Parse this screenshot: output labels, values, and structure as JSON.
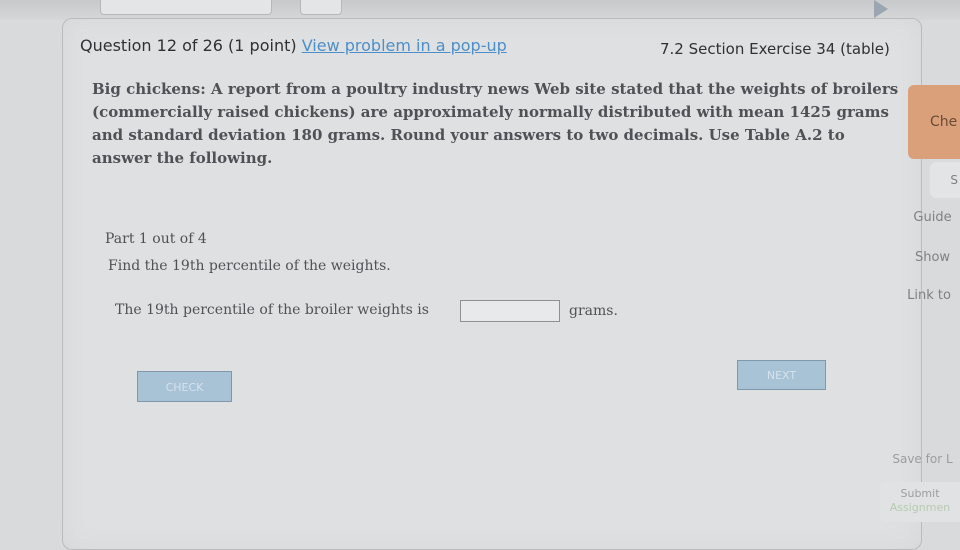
{
  "question": {
    "header_prefix": "Question 12 of 26 (1 point)",
    "popup_link": "View problem in a pop-up",
    "section": "7.2 Section Exercise 34 (table)"
  },
  "problem_lines": [
    "Big chickens: A report from a poultry industry news Web site stated that the weights of broilers",
    "(commercially raised chickens) are approximately normally distributed with mean 1425 grams",
    "and standard deviation 180 grams. Round your answers to two decimals. Use Table A.2 to",
    "answer the following."
  ],
  "part": {
    "title": "Part 1 out of 4",
    "task": "Find the 19th percentile of the weights.",
    "answer_prefix": "The 19th percentile of the broiler weights is",
    "answer_value": "",
    "answer_unit": "grams."
  },
  "buttons": {
    "check": "CHECK",
    "next": "NEXT"
  },
  "sidebar": {
    "check": "Che",
    "s": "S",
    "guided": "Guide",
    "show": "Show",
    "link": "Link to",
    "save": "Save for L",
    "submit_line1": "Submit",
    "submit_line2": "Assignmen"
  },
  "colors": {
    "link": "#4d8fc8",
    "primary_button": "#a9c3d6",
    "check_side_button": "#d9a07a"
  }
}
